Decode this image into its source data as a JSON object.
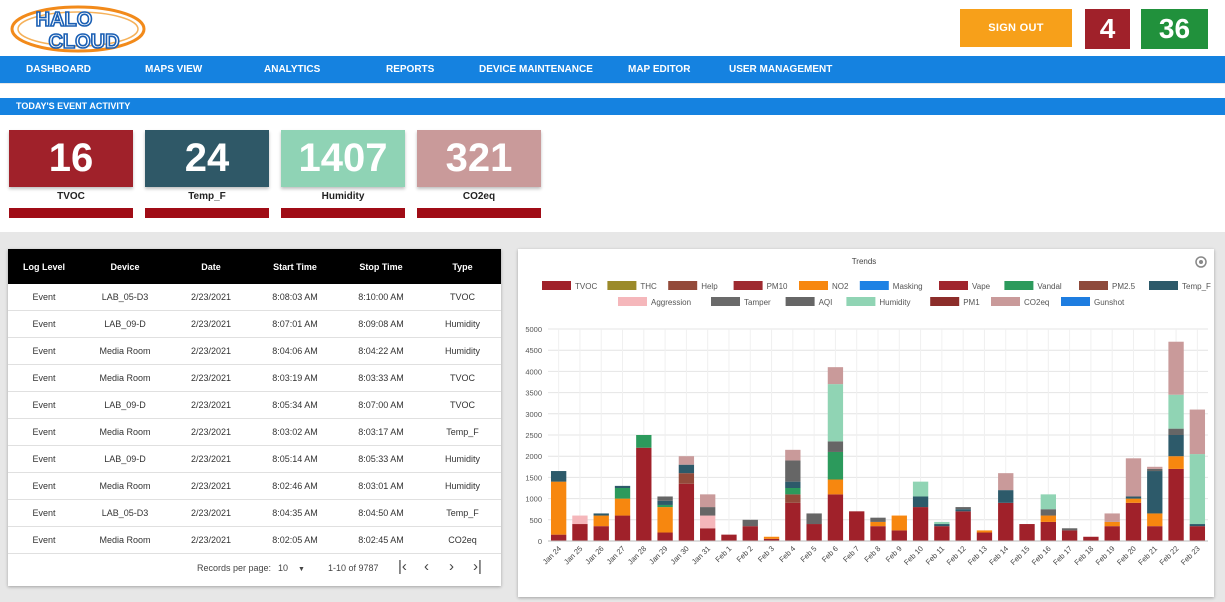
{
  "app": {
    "logo_text_top": "HALO",
    "logo_text_bottom": "CLOUD"
  },
  "header": {
    "signout_label": "SIGN OUT",
    "count_red": "4",
    "count_green": "36"
  },
  "nav": [
    "DASHBOARD",
    "MAPS VIEW",
    "ANALYTICS",
    "REPORTS",
    "DEVICE MAINTENANCE",
    "MAP EDITOR",
    "USER MANAGEMENT"
  ],
  "activity": {
    "title": "TODAY'S EVENT ACTIVITY",
    "cards": [
      {
        "value": "16",
        "label": "TVOC",
        "color": "#a0212a"
      },
      {
        "value": "24",
        "label": "Temp_F",
        "color": "#2f5867"
      },
      {
        "value": "1407",
        "label": "Humidity",
        "color": "#8fd3b5"
      },
      {
        "value": "321",
        "label": "CO2eq",
        "color": "#c99a9a"
      }
    ]
  },
  "log_table": {
    "headers": [
      "Log Level",
      "Device",
      "Date",
      "Start Time",
      "Stop Time",
      "Type"
    ],
    "rows": [
      [
        "Event",
        "LAB_05-D3",
        "2/23/2021",
        "8:08:03 AM",
        "8:10:00 AM",
        "TVOC"
      ],
      [
        "Event",
        "LAB_09-D",
        "2/23/2021",
        "8:07:01 AM",
        "8:09:08 AM",
        "Humidity"
      ],
      [
        "Event",
        "Media Room",
        "2/23/2021",
        "8:04:06 AM",
        "8:04:22 AM",
        "Humidity"
      ],
      [
        "Event",
        "Media Room",
        "2/23/2021",
        "8:03:19 AM",
        "8:03:33 AM",
        "TVOC"
      ],
      [
        "Event",
        "LAB_09-D",
        "2/23/2021",
        "8:05:34 AM",
        "8:07:00 AM",
        "TVOC"
      ],
      [
        "Event",
        "Media Room",
        "2/23/2021",
        "8:03:02 AM",
        "8:03:17 AM",
        "Temp_F"
      ],
      [
        "Event",
        "LAB_09-D",
        "2/23/2021",
        "8:05:14 AM",
        "8:05:33 AM",
        "Humidity"
      ],
      [
        "Event",
        "Media Room",
        "2/23/2021",
        "8:02:46 AM",
        "8:03:01 AM",
        "Humidity"
      ],
      [
        "Event",
        "LAB_05-D3",
        "2/23/2021",
        "8:04:35 AM",
        "8:04:50 AM",
        "Temp_F"
      ],
      [
        "Event",
        "Media Room",
        "2/23/2021",
        "8:02:05 AM",
        "8:02:45 AM",
        "CO2eq"
      ]
    ],
    "footer": {
      "records_label": "Records per page:",
      "per_page": "10",
      "range": "1-10 of 9787"
    }
  },
  "chart_data": {
    "type": "bar",
    "title": "Trends",
    "stacked": true,
    "legend_position": "top",
    "grid": true,
    "ylim": [
      0,
      5000
    ],
    "yticks": [
      0,
      500,
      1000,
      1500,
      2000,
      2500,
      3000,
      3500,
      4000,
      4500,
      5000
    ],
    "categories": [
      "Jan 24",
      "Jan 25",
      "Jan 26",
      "Jan 27",
      "Jan 28",
      "Jan 29",
      "Jan 30",
      "Jan 31",
      "Feb 1",
      "Feb 2",
      "Feb 3",
      "Feb 4",
      "Feb 5",
      "Feb 6",
      "Feb 7",
      "Feb 8",
      "Feb 9",
      "Feb 10",
      "Feb 11",
      "Feb 12",
      "Feb 13",
      "Feb 14",
      "Feb 15",
      "Feb 16",
      "Feb 17",
      "Feb 18",
      "Feb 19",
      "Feb 20",
      "Feb 21",
      "Feb 22",
      "Feb 23"
    ],
    "series": [
      {
        "name": "TVOC",
        "color": "#a0212a",
        "values": [
          150,
          400,
          350,
          600,
          2200,
          200,
          1350,
          300,
          150,
          350,
          50,
          900,
          400,
          1100,
          700,
          350,
          250,
          800,
          350,
          700,
          200,
          900,
          400,
          450,
          250,
          100,
          350,
          900,
          350,
          1700,
          350
        ]
      },
      {
        "name": "THC",
        "color": "#9b8a2a",
        "values": [
          0,
          0,
          0,
          0,
          0,
          0,
          0,
          0,
          0,
          0,
          0,
          0,
          0,
          0,
          0,
          0,
          0,
          0,
          0,
          0,
          0,
          0,
          0,
          0,
          0,
          0,
          0,
          0,
          0,
          0,
          0
        ]
      },
      {
        "name": "Help",
        "color": "#934a3a",
        "values": [
          0,
          0,
          0,
          0,
          0,
          0,
          250,
          0,
          0,
          0,
          0,
          200,
          0,
          0,
          0,
          0,
          0,
          0,
          0,
          0,
          0,
          0,
          0,
          0,
          0,
          0,
          0,
          0,
          0,
          0,
          0
        ]
      },
      {
        "name": "PM10",
        "color": "#9e2a30",
        "values": [
          0,
          0,
          0,
          0,
          0,
          0,
          0,
          0,
          0,
          0,
          0,
          0,
          0,
          0,
          0,
          0,
          0,
          0,
          0,
          0,
          0,
          0,
          0,
          0,
          0,
          0,
          0,
          0,
          0,
          0,
          0
        ]
      },
      {
        "name": "NO2",
        "color": "#f7870f",
        "values": [
          1250,
          0,
          250,
          400,
          0,
          600,
          0,
          0,
          0,
          0,
          50,
          0,
          0,
          350,
          0,
          100,
          350,
          0,
          0,
          0,
          50,
          0,
          0,
          150,
          0,
          0,
          100,
          100,
          300,
          300,
          0
        ]
      },
      {
        "name": "Masking",
        "color": "#1e82e4",
        "values": [
          0,
          0,
          0,
          0,
          0,
          0,
          0,
          0,
          0,
          0,
          0,
          0,
          0,
          0,
          0,
          0,
          0,
          0,
          0,
          0,
          0,
          0,
          0,
          0,
          0,
          0,
          0,
          0,
          0,
          0,
          0
        ]
      },
      {
        "name": "Vape",
        "color": "#a0252e",
        "values": [
          0,
          0,
          0,
          0,
          0,
          0,
          0,
          0,
          0,
          0,
          0,
          0,
          0,
          0,
          0,
          0,
          0,
          0,
          0,
          0,
          0,
          0,
          0,
          0,
          0,
          0,
          0,
          0,
          0,
          0,
          0
        ]
      },
      {
        "name": "Vandal",
        "color": "#2c9a5c",
        "values": [
          0,
          0,
          0,
          250,
          300,
          50,
          0,
          0,
          0,
          0,
          0,
          150,
          0,
          650,
          0,
          0,
          0,
          0,
          0,
          0,
          0,
          0,
          0,
          0,
          0,
          0,
          0,
          0,
          0,
          0,
          0
        ]
      },
      {
        "name": "PM2.5",
        "color": "#8e4a3b",
        "values": [
          0,
          0,
          0,
          0,
          0,
          0,
          0,
          0,
          0,
          0,
          0,
          0,
          0,
          0,
          0,
          0,
          0,
          0,
          0,
          0,
          0,
          0,
          0,
          0,
          0,
          0,
          0,
          0,
          0,
          0,
          0
        ]
      },
      {
        "name": "Temp_F",
        "color": "#2d5a6a",
        "values": [
          250,
          0,
          50,
          50,
          0,
          100,
          200,
          0,
          0,
          0,
          0,
          150,
          0,
          0,
          0,
          0,
          0,
          250,
          50,
          50,
          0,
          300,
          0,
          0,
          0,
          0,
          0,
          50,
          1000,
          500,
          50
        ]
      },
      {
        "name": "Aggression",
        "color": "#f5b7bb",
        "values": [
          0,
          200,
          0,
          0,
          0,
          0,
          0,
          300,
          0,
          0,
          0,
          0,
          0,
          0,
          0,
          0,
          0,
          0,
          0,
          0,
          0,
          0,
          0,
          0,
          0,
          0,
          0,
          0,
          0,
          0,
          0
        ]
      },
      {
        "name": "Tamper",
        "color": "#6a6a6a",
        "values": [
          0,
          0,
          0,
          0,
          0,
          0,
          0,
          0,
          0,
          0,
          0,
          0,
          0,
          0,
          0,
          0,
          0,
          0,
          0,
          0,
          0,
          0,
          0,
          0,
          0,
          0,
          0,
          0,
          0,
          0,
          0
        ]
      },
      {
        "name": "AQI",
        "color": "#666666",
        "values": [
          0,
          0,
          0,
          0,
          0,
          100,
          0,
          200,
          0,
          150,
          0,
          500,
          250,
          250,
          0,
          100,
          0,
          0,
          0,
          50,
          0,
          0,
          0,
          150,
          50,
          0,
          0,
          0,
          50,
          150,
          0
        ]
      },
      {
        "name": "Humidity",
        "color": "#90d4b4",
        "values": [
          0,
          0,
          0,
          0,
          0,
          0,
          0,
          0,
          0,
          0,
          0,
          0,
          0,
          1350,
          0,
          0,
          0,
          350,
          50,
          0,
          0,
          0,
          0,
          350,
          0,
          0,
          0,
          0,
          0,
          800,
          1650
        ]
      },
      {
        "name": "PM1",
        "color": "#8c2d2a",
        "values": [
          0,
          0,
          0,
          0,
          0,
          0,
          0,
          0,
          0,
          0,
          0,
          0,
          0,
          0,
          0,
          0,
          0,
          0,
          0,
          0,
          0,
          0,
          0,
          0,
          0,
          0,
          0,
          0,
          0,
          0,
          0
        ]
      },
      {
        "name": "CO2eq",
        "color": "#c99a9a",
        "values": [
          0,
          0,
          0,
          0,
          0,
          0,
          200,
          300,
          0,
          0,
          0,
          250,
          0,
          400,
          0,
          0,
          0,
          0,
          0,
          0,
          0,
          400,
          0,
          0,
          0,
          0,
          200,
          900,
          50,
          1250,
          1050
        ]
      },
      {
        "name": "Gunshot",
        "color": "#1e7de0",
        "values": [
          0,
          0,
          0,
          0,
          0,
          0,
          0,
          0,
          0,
          0,
          0,
          0,
          0,
          0,
          0,
          0,
          0,
          0,
          0,
          0,
          0,
          0,
          0,
          0,
          0,
          0,
          0,
          0,
          0,
          0,
          0
        ]
      }
    ]
  }
}
